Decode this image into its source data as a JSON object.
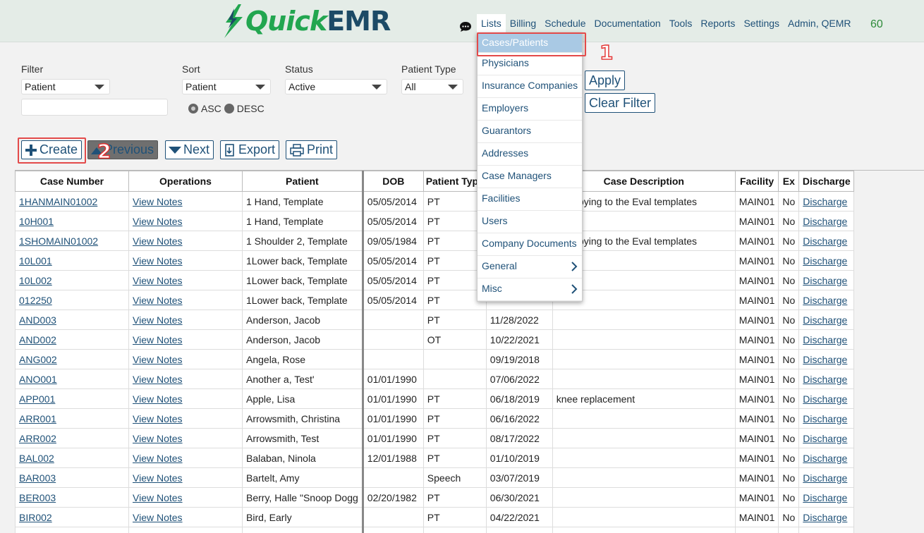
{
  "app": {
    "logo_quick": "Quick",
    "logo_emr": "EMR"
  },
  "nav": {
    "items": [
      "Lists",
      "Billing",
      "Schedule",
      "Documentation",
      "Tools",
      "Reports",
      "Settings",
      "Admin, QEMR"
    ],
    "count": "60",
    "chat_icon": "chat-bubble-icon"
  },
  "filters": {
    "filter_label": "Filter",
    "filter_value": "Patient",
    "sort_label": "Sort",
    "sort_value": "Patient",
    "status_label": "Status",
    "status_value": "Active",
    "ptype_label": "Patient Type",
    "ptype_value": "All",
    "asc_label": "ASC",
    "desc_label": "DESC",
    "apply_label": "Apply",
    "clear_label": "Clear Filter"
  },
  "toolbar": {
    "create": "Create",
    "previous": "Previous",
    "next": "Next",
    "export": "Export",
    "print": "Print"
  },
  "annotations": {
    "one": "1",
    "two": "2"
  },
  "menu": {
    "items": [
      "Cases/Patients",
      "Physicians",
      "Insurance Companies",
      "Employers",
      "Guarantors",
      "Addresses",
      "Case Managers",
      "Facilities",
      "Users",
      "Company Documents",
      "General",
      "Misc"
    ]
  },
  "table": {
    "headers": [
      "Case Number",
      "Operations",
      "Patient",
      "DOB",
      "Patient Type",
      "",
      "Case Description",
      "Facility",
      "Ex",
      "Discharge"
    ],
    "rows": [
      [
        "1HANMAIN01002",
        "View Notes",
        "1 Hand, Template",
        "05/05/2014",
        "PT",
        "",
        "or copying to the Eval templates",
        "MAIN01",
        "No",
        "Discharge"
      ],
      [
        "10H001",
        "View Notes",
        "1 Hand, Template",
        "05/05/2014",
        "PT",
        "",
        "",
        "MAIN01",
        "No",
        "Discharge"
      ],
      [
        "1SHOMAIN01002",
        "View Notes",
        "1 Shoulder 2, Template",
        "09/05/1984",
        "PT",
        "",
        "or copying to the Eval templates",
        "MAIN01",
        "No",
        "Discharge"
      ],
      [
        "10L001",
        "View Notes",
        "1Lower back, Template",
        "05/05/2014",
        "PT",
        "",
        "",
        "MAIN01",
        "No",
        "Discharge"
      ],
      [
        "10L002",
        "View Notes",
        "1Lower back, Template",
        "05/05/2014",
        "PT",
        "",
        "",
        "MAIN01",
        "No",
        "Discharge"
      ],
      [
        "012250",
        "View Notes",
        "1Lower back, Template",
        "05/05/2014",
        "PT",
        "",
        "",
        "MAIN01",
        "No",
        "Discharge"
      ],
      [
        "AND003",
        "View Notes",
        "Anderson, Jacob",
        "",
        "PT",
        "11/28/2022",
        "",
        "MAIN01",
        "No",
        "Discharge"
      ],
      [
        "AND002",
        "View Notes",
        "Anderson, Jacob",
        "",
        "OT",
        "10/22/2021",
        "",
        "MAIN01",
        "No",
        "Discharge"
      ],
      [
        "ANG002",
        "View Notes",
        "Angela, Rose",
        "",
        "",
        "09/19/2018",
        "",
        "MAIN01",
        "No",
        "Discharge"
      ],
      [
        "ANO001",
        "View Notes",
        "Another a, Test'",
        "01/01/1990",
        "",
        "07/06/2022",
        "",
        "MAIN01",
        "No",
        "Discharge"
      ],
      [
        "APP001",
        "View Notes",
        "Apple, Lisa",
        "01/01/1990",
        "PT",
        "06/18/2019",
        "knee replacement",
        "MAIN01",
        "No",
        "Discharge"
      ],
      [
        "ARR001",
        "View Notes",
        "Arrowsmith, Christina",
        "01/01/1990",
        "PT",
        "06/16/2022",
        "",
        "MAIN01",
        "No",
        "Discharge"
      ],
      [
        "ARR002",
        "View Notes",
        "Arrowsmith, Test",
        "01/01/1990",
        "PT",
        "08/17/2022",
        "",
        "MAIN01",
        "No",
        "Discharge"
      ],
      [
        "BAL002",
        "View Notes",
        "Balaban, Ninola",
        "12/01/1988",
        "PT",
        "01/10/2019",
        "",
        "MAIN01",
        "No",
        "Discharge"
      ],
      [
        "BAR003",
        "View Notes",
        "Bartelt, Amy",
        "",
        "Speech",
        "03/07/2019",
        "",
        "MAIN01",
        "No",
        "Discharge"
      ],
      [
        "BER003",
        "View Notes",
        "Berry, Halle \"Snoop Dogg",
        "02/20/1982",
        "PT",
        "06/30/2021",
        "",
        "MAIN01",
        "No",
        "Discharge"
      ],
      [
        "BIR002",
        "View Notes",
        "Bird, Early",
        "",
        "PT",
        "04/22/2021",
        "",
        "MAIN01",
        "No",
        "Discharge"
      ],
      [
        "",
        "",
        "",
        "",
        "",
        "",
        "",
        "",
        "",
        ""
      ]
    ]
  }
}
